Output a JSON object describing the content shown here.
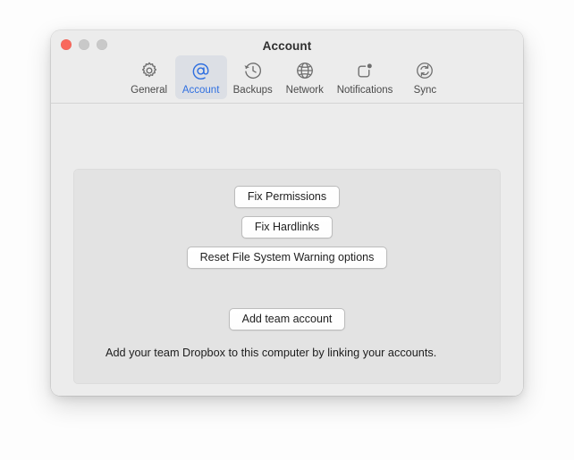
{
  "window": {
    "title": "Account",
    "traffic_lights": [
      {
        "name": "close",
        "color": "#f9685c"
      },
      {
        "name": "minimize",
        "color": "#c9c9c9"
      },
      {
        "name": "maximize",
        "color": "#c9c9c9"
      }
    ]
  },
  "toolbar": {
    "selected": "Account",
    "accent_color": "#2f6fe0",
    "selected_background": "#dcdfe5",
    "tabs": [
      {
        "label": "General",
        "icon": "gear-icon",
        "selected": false
      },
      {
        "label": "Account",
        "icon": "at-sign-icon",
        "selected": true
      },
      {
        "label": "Backups",
        "icon": "clock-rewind-icon",
        "selected": false
      },
      {
        "label": "Network",
        "icon": "globe-icon",
        "selected": false
      },
      {
        "label": "Notifications",
        "icon": "notification-badge-icon",
        "selected": false
      },
      {
        "label": "Sync",
        "icon": "sync-refresh-icon",
        "selected": false
      }
    ]
  },
  "panel": {
    "buttons": [
      {
        "label": "Fix Permissions"
      },
      {
        "label": "Fix Hardlinks"
      },
      {
        "label": "Reset File System Warning options"
      },
      {
        "label": "Add team account"
      }
    ],
    "description": "Add your team Dropbox to this computer by linking your accounts."
  }
}
